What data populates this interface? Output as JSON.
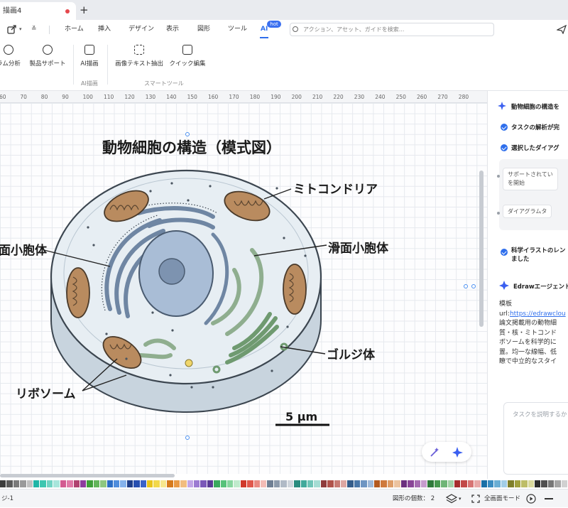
{
  "window": {
    "tab_title": "描画4"
  },
  "menu": {
    "items": [
      "ホーム",
      "挿入",
      "デザイン",
      "表示",
      "図形",
      "ツール",
      "AI"
    ],
    "hot_badge": "hot",
    "search_placeholder": "アクション、アセット、ガイドを検索..."
  },
  "ribbon": {
    "buttons": [
      "ラム分析",
      "製品サポート",
      "AI描画",
      "画像テキスト抽出",
      "クイック編集"
    ],
    "groups": [
      "AI描画",
      "スマートツール"
    ]
  },
  "ruler": {
    "ticks": [
      "60",
      "70",
      "80",
      "90",
      "100",
      "110",
      "120",
      "130",
      "140",
      "150",
      "160",
      "170",
      "180",
      "190",
      "200",
      "210",
      "220",
      "230",
      "240",
      "250",
      "260",
      "270",
      "280"
    ]
  },
  "diagram": {
    "title": "動物細胞の構造（模式図）",
    "labels": {
      "mitochondria": "ミトコンドリア",
      "smooth_er": "滑面小胞体",
      "rough_er": "面小胞体",
      "golgi": "ゴルジ体",
      "ribosome": "リボソーム"
    },
    "scale_bar": "5 μm"
  },
  "panel": {
    "header": "動物細胞の構造を",
    "step1": "タスクの解析が完",
    "step2": "選択したダイアグ",
    "chip1_line1": "サポートされてい",
    "chip1_line2": "を開始",
    "chip2": "ダイアグラムタ",
    "step3_line1": "科学イラストのレン",
    "step3_line2": "ました",
    "agent_title": "Edrawエージェント",
    "body_lines": [
      "模板",
      "url:",
      "論文掲載用の動物細",
      "質・核・ミトコンド",
      "ボソームを科学的に",
      "置。均一な線幅、低",
      "瞭で中立的なスタイ"
    ],
    "link_text": "https://edrawclou",
    "task_placeholder": "タスクを説明するか"
  },
  "status": {
    "page": "ジ-1",
    "shape_count": "図形の個数： 2",
    "fullscreen": "全画面モード"
  },
  "colors": {
    "accent": "#2f6fec",
    "palette": [
      "#3c3c3c",
      "#5a5a5a",
      "#7a7a7a",
      "#9a9a9a",
      "#c0c0c0",
      "#1fb5a6",
      "#3cc6b0",
      "#70d3c3",
      "#a7e5db",
      "#d35a91",
      "#e07aa8",
      "#b04370",
      "#8d3c9e",
      "#3f9f3a",
      "#63b55b",
      "#8ec77f",
      "#2c6ec4",
      "#4f8ddc",
      "#84b2ec",
      "#1f3f8a",
      "#274fb0",
      "#3a63c9",
      "#e8c41c",
      "#f2d84a",
      "#f7e78e",
      "#d67a1c",
      "#e99a45",
      "#f2bd7f",
      "#c2a6e6",
      "#9c7bd2",
      "#7a57b8",
      "#5a3b95",
      "#3aa95e",
      "#57c27a",
      "#87d69f",
      "#bfeacc",
      "#d0392b",
      "#e0584c",
      "#e98a82",
      "#f3bcb6",
      "#6f7f93",
      "#8c9aab",
      "#b0bac6",
      "#cfd5dc",
      "#2a8c7f",
      "#41a99b",
      "#6ec4b7",
      "#a4dcd3",
      "#8e3b3b",
      "#b0534b",
      "#c77b74",
      "#dda7a2",
      "#355d8a",
      "#4a77a8",
      "#6e95c2",
      "#9fb9d9",
      "#b3591f",
      "#cf7a3d",
      "#de9d68",
      "#ecc39f",
      "#6b2f7e",
      "#894597",
      "#a56cb1",
      "#c69ccd",
      "#2f7a3a",
      "#47984f",
      "#6fb577",
      "#a2d1a6",
      "#a62d2d",
      "#c24848",
      "#d77474",
      "#e8a8a8",
      "#1a6fa6",
      "#3a8cc0",
      "#6aaed4",
      "#a2cde6",
      "#7f7f2a",
      "#a0a03e",
      "#bdbd67",
      "#d9d99d",
      "#2d2d2d",
      "#505050",
      "#777",
      "#a5a5a5",
      "#d1d1d1"
    ]
  }
}
